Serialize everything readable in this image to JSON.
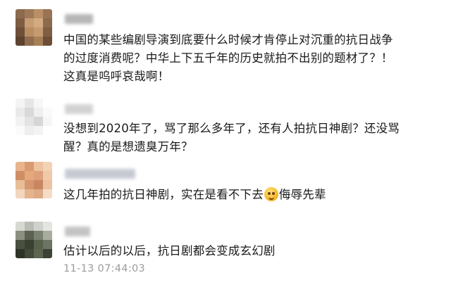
{
  "comments": [
    {
      "avatar": "avatar-1",
      "lines": [
        "中国的某些编剧导演到底要什么时候才肯停止对沉重的抗日战争",
        "的过度消费呢？中华上下五千年的历史就拍不出别的题材了？！",
        "这真是呜呼哀哉啊！"
      ]
    },
    {
      "avatar": "avatar-2",
      "lines": [
        "没想到2020年了，骂了那么多年了，还有人拍抗日神剧？还没骂",
        "醒？真的是想遗臭万年？"
      ]
    },
    {
      "avatar": "avatar-3",
      "text_before": "这几年拍的抗日神剧，实在是看不下去",
      "emoji": "smile-emoji",
      "text_after": "侮辱先辈"
    },
    {
      "avatar": "avatar-4",
      "lines": [
        "估计以后的以后，抗日剧都会变成玄幻剧"
      ]
    }
  ],
  "timestamp": "11-13 07:44:03",
  "colors": {
    "text": "#1a1a1a",
    "timestamp": "#9b9b9b",
    "background": "#ffffff"
  }
}
